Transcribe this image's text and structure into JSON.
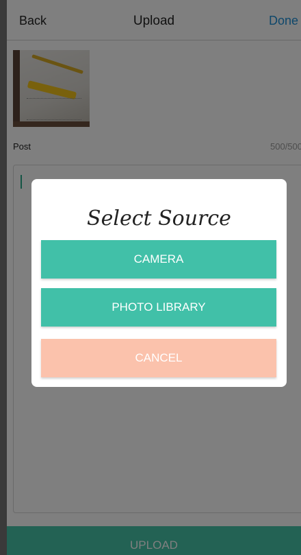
{
  "navbar": {
    "back_label": "Back",
    "title": "Upload",
    "done_label": "Done"
  },
  "post": {
    "label": "Post",
    "char_count": "500/500"
  },
  "footer": {
    "upload_label": "UPLOAD"
  },
  "dialog": {
    "title": "Select Source",
    "camera_label": "CAMERA",
    "library_label": "PHOTO LIBRARY",
    "cancel_label": "CANCEL"
  },
  "colors": {
    "accent": "#41c0a8",
    "cancel": "#fbc2ac",
    "link": "#1c8fd6"
  }
}
